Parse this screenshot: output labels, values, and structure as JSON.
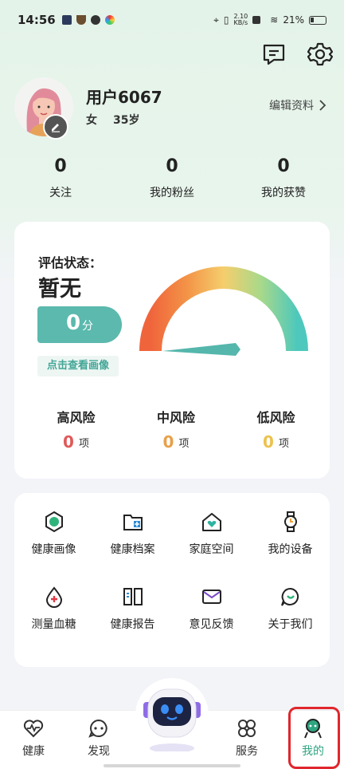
{
  "status_bar": {
    "time": "14:56",
    "net_speed_value": "2.10",
    "net_speed_unit": "KB/s",
    "battery": "21%"
  },
  "profile": {
    "username": "用户6067",
    "gender": "女",
    "age": "35岁",
    "edit_label": "编辑资料"
  },
  "stats": [
    {
      "value": "0",
      "label": "关注"
    },
    {
      "value": "0",
      "label": "我的粉丝"
    },
    {
      "value": "0",
      "label": "我的获赞"
    }
  ],
  "assessment": {
    "label": "评估状态：",
    "value": "暂无",
    "score": "0",
    "score_unit": "分",
    "view_button": "点击查看画像",
    "risks": [
      {
        "title": "高风险",
        "count": "0",
        "unit": "项",
        "color": "#e05a5a"
      },
      {
        "title": "中风险",
        "count": "0",
        "unit": "项",
        "color": "#e8a04a"
      },
      {
        "title": "低风险",
        "count": "0",
        "unit": "项",
        "color": "#ecc24e"
      }
    ]
  },
  "services": [
    {
      "label": "健康画像",
      "icon": "health-profile-icon"
    },
    {
      "label": "健康档案",
      "icon": "health-record-icon"
    },
    {
      "label": "家庭空间",
      "icon": "family-home-icon"
    },
    {
      "label": "我的设备",
      "icon": "watch-device-icon"
    },
    {
      "label": "测量血糖",
      "icon": "blood-drop-icon"
    },
    {
      "label": "健康报告",
      "icon": "report-book-icon"
    },
    {
      "label": "意见反馈",
      "icon": "mail-feedback-icon"
    },
    {
      "label": "关于我们",
      "icon": "chat-about-icon"
    }
  ],
  "tabs": [
    {
      "label": "健康",
      "icon": "heart-pulse-icon"
    },
    {
      "label": "发现",
      "icon": "discover-icon"
    },
    {
      "label": "服务",
      "icon": "service-grid-icon"
    },
    {
      "label": "我的",
      "icon": "profile-icon",
      "active": true
    }
  ],
  "colors": {
    "accent": "#5bb9ad",
    "active_tab": "#2ea581",
    "highlight": "#e0262d"
  }
}
